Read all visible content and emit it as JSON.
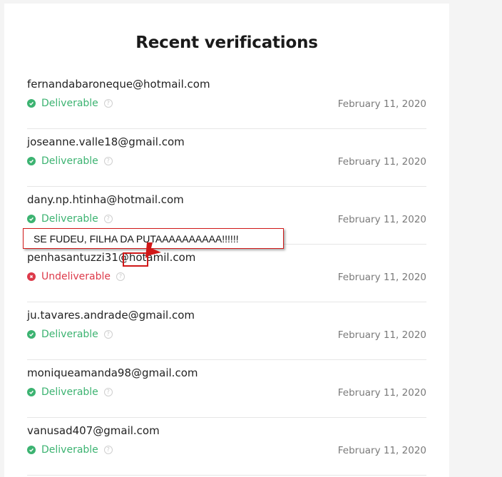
{
  "page": {
    "title": "Recent verifications"
  },
  "verifications": [
    {
      "email": "fernandabaroneque@hotmail.com",
      "status": "Deliverable",
      "date": "February 11, 2020"
    },
    {
      "email": "joseanne.valle18@gmail.com",
      "status": "Deliverable",
      "date": "February 11, 2020"
    },
    {
      "email": "dany.np.htinha@hotmail.com",
      "status": "Deliverable",
      "date": "February 11, 2020"
    },
    {
      "email": "penhasantuzzi31@hotamil.com",
      "status": "Undeliverable",
      "date": "February 11, 2020"
    },
    {
      "email": "ju.tavares.andrade@gmail.com",
      "status": "Deliverable",
      "date": "February 11, 2020"
    },
    {
      "email": "moniqueamanda98@gmail.com",
      "status": "Deliverable",
      "date": "February 11, 2020"
    },
    {
      "email": "vanusad407@gmail.com",
      "status": "Deliverable",
      "date": "February 11, 2020"
    }
  ],
  "annotation": {
    "text": "SE FUDEU, FILHA DA PUTAAAAAAAAAA!!!!!!"
  },
  "colors": {
    "deliverable": "#3cb371",
    "undeliverable": "#dd3a4a",
    "annotation_border": "#d01818"
  },
  "icons": {
    "deliverable": "check-circle-icon",
    "undeliverable": "x-circle-icon",
    "help": "help-circle-icon"
  }
}
